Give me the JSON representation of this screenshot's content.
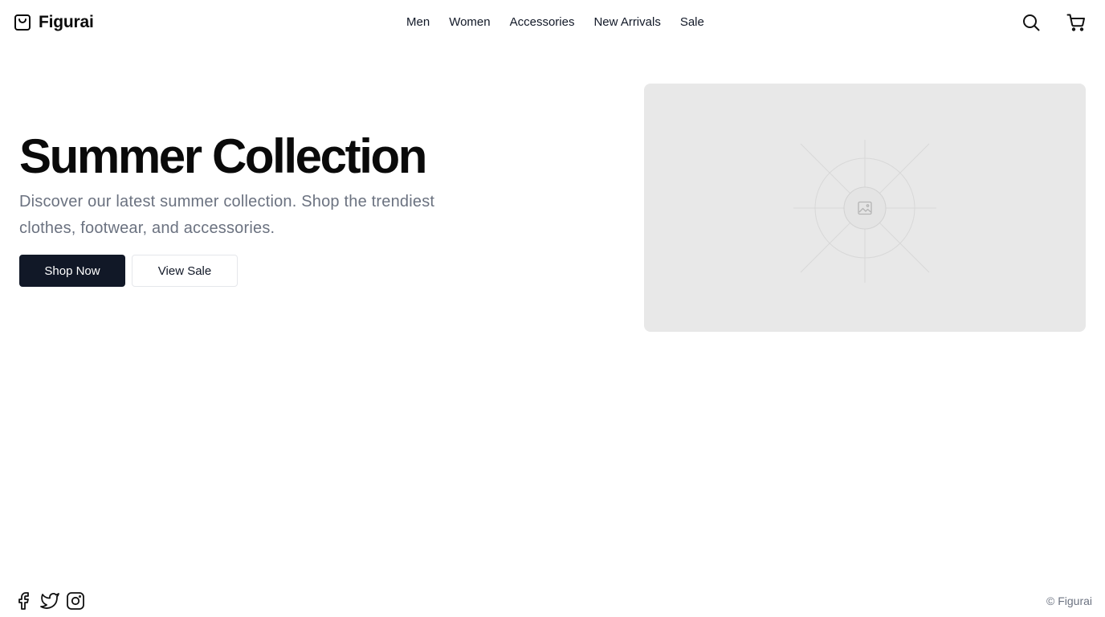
{
  "brand": {
    "name": "Figurai",
    "icon": "shopping-bag-icon"
  },
  "nav": {
    "items": [
      {
        "label": "Men"
      },
      {
        "label": "Women"
      },
      {
        "label": "Accessories"
      },
      {
        "label": "New Arrivals"
      },
      {
        "label": "Sale"
      }
    ]
  },
  "header_actions": {
    "search_icon": "search-icon",
    "cart_icon": "shopping-cart-icon"
  },
  "hero": {
    "title": "Summer Collection",
    "subtitle": "Discover our latest summer collection. Shop the trendiest clothes, footwear, and accessories.",
    "primary_button": "Shop Now",
    "secondary_button": "View Sale",
    "image_icon": "image-placeholder-icon"
  },
  "footer": {
    "social_icons": [
      "facebook-icon",
      "twitter-icon",
      "instagram-icon"
    ],
    "copyright": "© Figurai"
  },
  "colors": {
    "primary": "#111827",
    "muted_text": "#6b7280",
    "placeholder_bg": "#e8e8e8"
  }
}
